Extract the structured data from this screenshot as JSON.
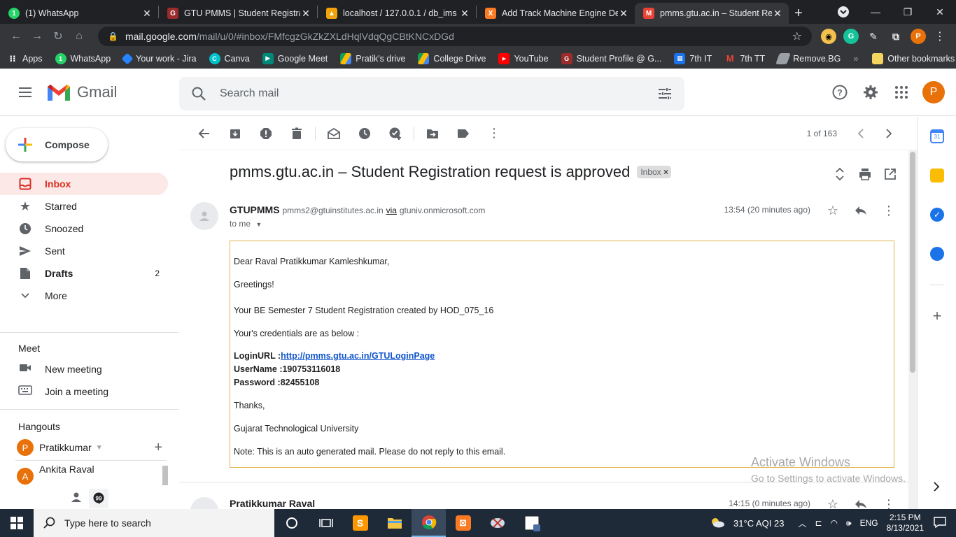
{
  "browser": {
    "tabs": [
      {
        "title": "(1) WhatsApp",
        "color": "#25d366",
        "glyph": "1"
      },
      {
        "title": "GTU PMMS | Student Registra",
        "color": "#9c2b2b",
        "glyph": "G"
      },
      {
        "title": "localhost / 127.0.0.1 / db_ims",
        "color": "#f0a30a",
        "glyph": "▲"
      },
      {
        "title": "Add Track Machine Engine De",
        "color": "#fb7a24",
        "glyph": "X"
      },
      {
        "title": "pmms.gtu.ac.in – Student Req",
        "color": "#ea4335",
        "glyph": "M"
      }
    ],
    "url_host": "mail.google.com",
    "url_path": "/mail/u/0/#inbox/FMfcgzGkZkZXLdHqlVdqQgCBtKNCxDGd",
    "profile_initial": "P",
    "bookmarks": [
      {
        "label": "Apps",
        "color": "#5f6368"
      },
      {
        "label": "WhatsApp",
        "color": "#25d366"
      },
      {
        "label": "Your work - Jira",
        "color": "#2684ff"
      },
      {
        "label": "Canva",
        "color": "#00c4cc"
      },
      {
        "label": "Google Meet",
        "color": "#00897b"
      },
      {
        "label": "Pratik's drive",
        "color": "#fbbc04"
      },
      {
        "label": "College Drive",
        "color": "#34a853"
      },
      {
        "label": "YouTube",
        "color": "#ff0000"
      },
      {
        "label": "Student Profile @ G...",
        "color": "#9c2b2b"
      },
      {
        "label": "7th IT",
        "color": "#1a73e8"
      },
      {
        "label": "7th TT",
        "color": "#ea4335"
      },
      {
        "label": "Remove.BG",
        "color": "#9aa0a6"
      }
    ],
    "other_bookmarks": "Other bookmarks",
    "more_bookmarks": "»"
  },
  "gmail": {
    "product_name": "Gmail",
    "search_placeholder": "Search mail",
    "account_initial": "P",
    "compose_label": "Compose",
    "nav": [
      {
        "label": "Inbox",
        "icon": "inbox-icon",
        "count": "",
        "active": true,
        "bold": true
      },
      {
        "label": "Starred",
        "icon": "star-icon",
        "count": "",
        "active": false,
        "bold": false
      },
      {
        "label": "Snoozed",
        "icon": "clock-icon",
        "count": "",
        "active": false,
        "bold": false
      },
      {
        "label": "Sent",
        "icon": "send-icon",
        "count": "",
        "active": false,
        "bold": false
      },
      {
        "label": "Drafts",
        "icon": "draft-icon",
        "count": "2",
        "active": false,
        "bold": true
      },
      {
        "label": "More",
        "icon": "chevron-down-icon",
        "count": "",
        "active": false,
        "bold": false
      }
    ],
    "meet": {
      "title": "Meet",
      "items": [
        {
          "label": "New meeting",
          "icon": "video-icon"
        },
        {
          "label": "Join a meeting",
          "icon": "keyboard-icon"
        }
      ]
    },
    "hangouts": {
      "title": "Hangouts",
      "user": "Pratikkumar",
      "user_initial": "P",
      "contact": "Ankita Raval",
      "contact_initial": "A"
    },
    "pager": "1 of 163",
    "email": {
      "subject": "pmms.gtu.ac.in – Student Registration request is approved",
      "label": "Inbox",
      "sender_name": "GTUPMMS",
      "sender_email": "pmms2@gtuinstitutes.ac.in",
      "via_label": "via",
      "via_domain": "gtuniv.onmicrosoft.com",
      "to": "to me",
      "time": "13:54 (20 minutes ago)",
      "body": {
        "greeting": "Dear Raval Pratikkumar Kamleshkumar,",
        "greetings": "Greetings!",
        "line1": "Your BE Semester 7 Student Registration created by HOD_075_16",
        "line2": "Your's credentials are as below :",
        "login_label": "LoginURL :",
        "login_url": "http://pmms.gtu.ac.in/GTULoginPage",
        "username_label": "UserName :",
        "username": "190753116018",
        "password_label": "Password :",
        "password": "82455108",
        "thanks": "Thanks,",
        "org": "Gujarat Technological University",
        "note": "Note: This is an auto generated mail. Please do not reply to this email."
      }
    },
    "reply": {
      "sender_name": "Pratikkumar Raval",
      "time": "14:15 (0 minutes ago)"
    },
    "activate_windows": {
      "title": "Activate Windows",
      "subtitle": "Go to Settings to activate Windows."
    }
  },
  "taskbar": {
    "search_placeholder": "Type here to search",
    "weather": "31°C  AQI 23",
    "language": "ENG",
    "time": "2:15 PM",
    "date": "8/13/2021"
  }
}
